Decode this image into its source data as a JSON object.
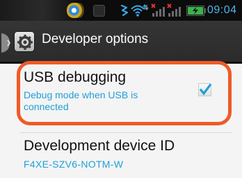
{
  "status_bar": {
    "time": "09:04",
    "icons": [
      "app-notification-icon",
      "settings-notification-icon",
      "vibrate-icon",
      "wifi-icon",
      "signal-icon",
      "signal-icon",
      "battery-icon"
    ]
  },
  "action_bar": {
    "title": "Developer options",
    "icon": "settings-gear-icon"
  },
  "settings": [
    {
      "title": "USB debugging",
      "summary_line1": "Debug mode when USB is",
      "summary_line2": "connected",
      "checked": true,
      "highlighted": true
    },
    {
      "title": "Development device ID",
      "summary": "F4XE-SZV6-NOTM-W"
    }
  ],
  "colors": {
    "accent": "#1f9fd8",
    "highlight": "#ef5a26",
    "action_bar": "#2f2f2f",
    "time": "#4fb3e8"
  }
}
